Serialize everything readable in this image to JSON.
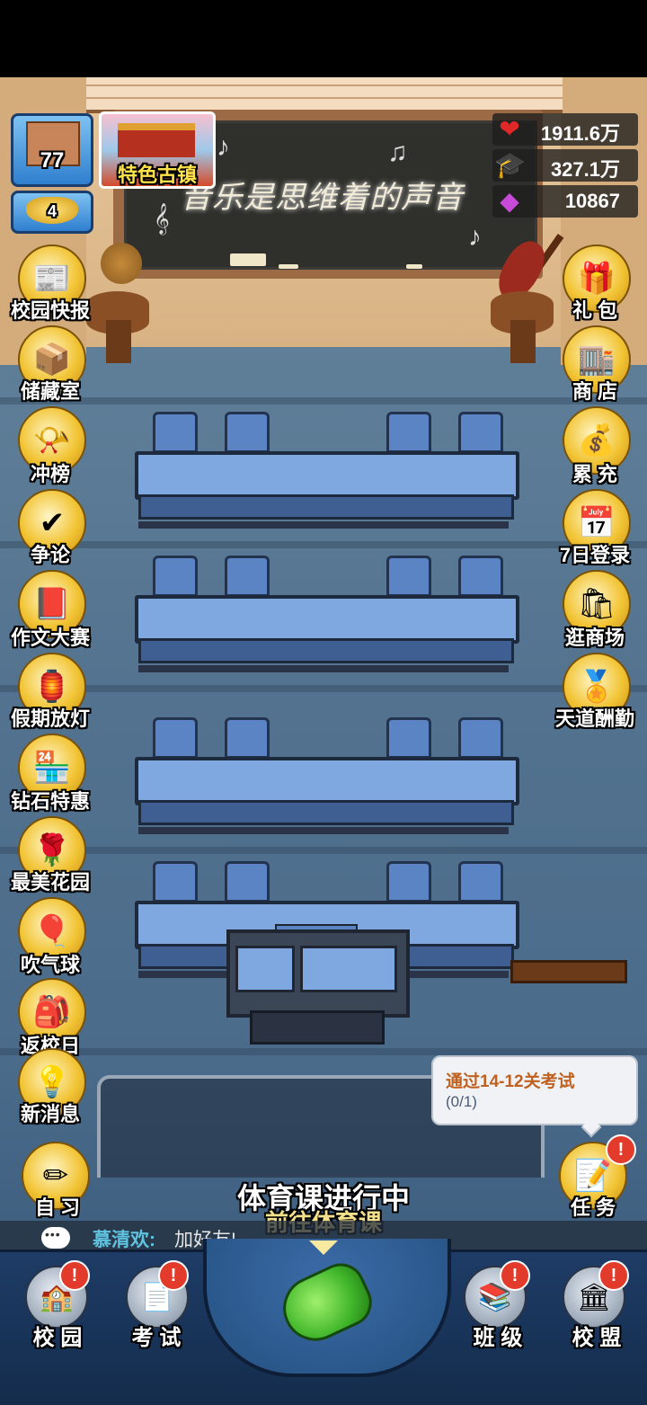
{
  "hud": {
    "school_level": "77",
    "rank_level": "4",
    "town_button": "特色古镇",
    "stats": [
      {
        "icon": "heart-icon",
        "value": "1911.6万"
      },
      {
        "icon": "graduation-cap-icon",
        "value": "327.1万"
      },
      {
        "icon": "diamond-icon",
        "value": "10867"
      }
    ]
  },
  "blackboard": {
    "text": "音乐是思维着的声音"
  },
  "left_menu": [
    {
      "label": "校园快报",
      "icon": "newspaper-icon"
    },
    {
      "label": "储藏室",
      "icon": "boxes-icon"
    },
    {
      "label": "冲榜",
      "icon": "trumpet-icon"
    },
    {
      "label": "争论",
      "icon": "debate-icon"
    },
    {
      "label": "作文大赛",
      "icon": "essay-book-icon"
    },
    {
      "label": "假期放灯",
      "icon": "lantern-icon"
    },
    {
      "label": "钻石特惠",
      "icon": "shop-icon"
    },
    {
      "label": "最美花园",
      "icon": "flower-icon"
    },
    {
      "label": "吹气球",
      "icon": "balloon-icon"
    },
    {
      "label": "返校日",
      "icon": "return-school-icon"
    },
    {
      "label": "新消息",
      "icon": "lightbulb-icon"
    }
  ],
  "right_menu": [
    {
      "label": "礼 包",
      "icon": "gift-icon"
    },
    {
      "label": "商 店",
      "icon": "store-icon"
    },
    {
      "label": "累 充",
      "icon": "treasure-icon"
    },
    {
      "label": "7日登录",
      "icon": "calendar-icon"
    },
    {
      "label": "逛商场",
      "icon": "mall-icon"
    },
    {
      "label": "天道酬勤",
      "icon": "medal-icon"
    }
  ],
  "self_study": {
    "label": "自 习"
  },
  "task_bubble": {
    "title": "通过14-12关考试",
    "progress": "(0/1)"
  },
  "task_button": {
    "label": "任 务"
  },
  "class_status": {
    "title": "体育课进行中",
    "subtitle": "前往体育课"
  },
  "chat": {
    "name": "慕清欢:",
    "message": "加好友!"
  },
  "bottom_nav": [
    {
      "label": "校 园",
      "icon": "school-building-icon",
      "badge": "!"
    },
    {
      "label": "考 试",
      "icon": "exam-paper-icon",
      "badge": "!"
    },
    {
      "label": "班 级",
      "icon": "class-book-icon",
      "badge": "!"
    },
    {
      "label": "校 盟",
      "icon": "alliance-icon",
      "badge": "!"
    }
  ]
}
